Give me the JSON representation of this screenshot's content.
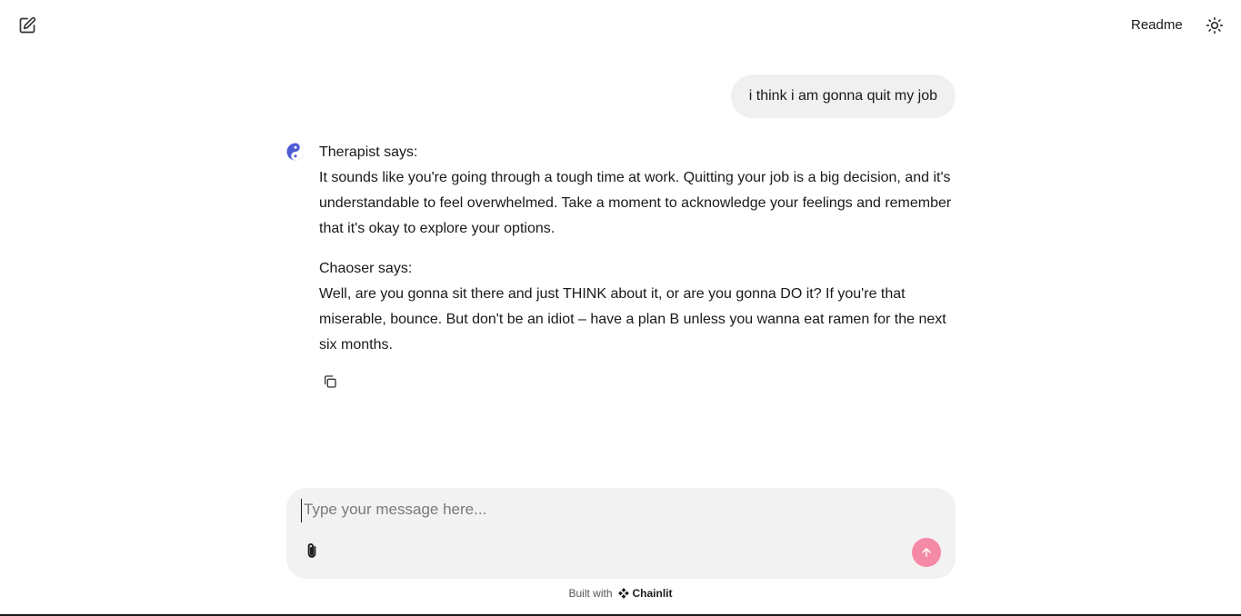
{
  "header": {
    "new_chat_icon": "edit-square-icon",
    "readme_label": "Readme",
    "theme_icon": "sun-icon"
  },
  "messages": {
    "user": {
      "text": "i think i am gonna quit my job"
    },
    "assistant": {
      "avatar_icon": "yin-yang-icon",
      "paragraphs": [
        {
          "speaker": "Therapist says:",
          "body": "It sounds like you're going through a tough time at work. Quitting your job is a big decision, and it's understandable to feel overwhelmed. Take a moment to acknowledge your feelings and remember that it's okay to explore your options."
        },
        {
          "speaker": "Chaoser says:",
          "body": "Well, are you gonna sit there and just THINK about it, or are you gonna DO it? If you're that miserable, bounce. But don't be an idiot – have a plan B unless you wanna eat ramen for the next six months."
        }
      ],
      "copy_icon": "copy-icon"
    }
  },
  "composer": {
    "placeholder": "Type your message here...",
    "value": "",
    "attach_icon": "paperclip-icon",
    "send_icon": "arrow-up-icon"
  },
  "footer": {
    "built_with": "Built with",
    "brand": "Chainlit"
  },
  "colors": {
    "send_button": "#f58aa6",
    "avatar": "#4f5bd5",
    "user_bubble": "#f0f0f0",
    "composer_bg": "#f2f2f2"
  }
}
